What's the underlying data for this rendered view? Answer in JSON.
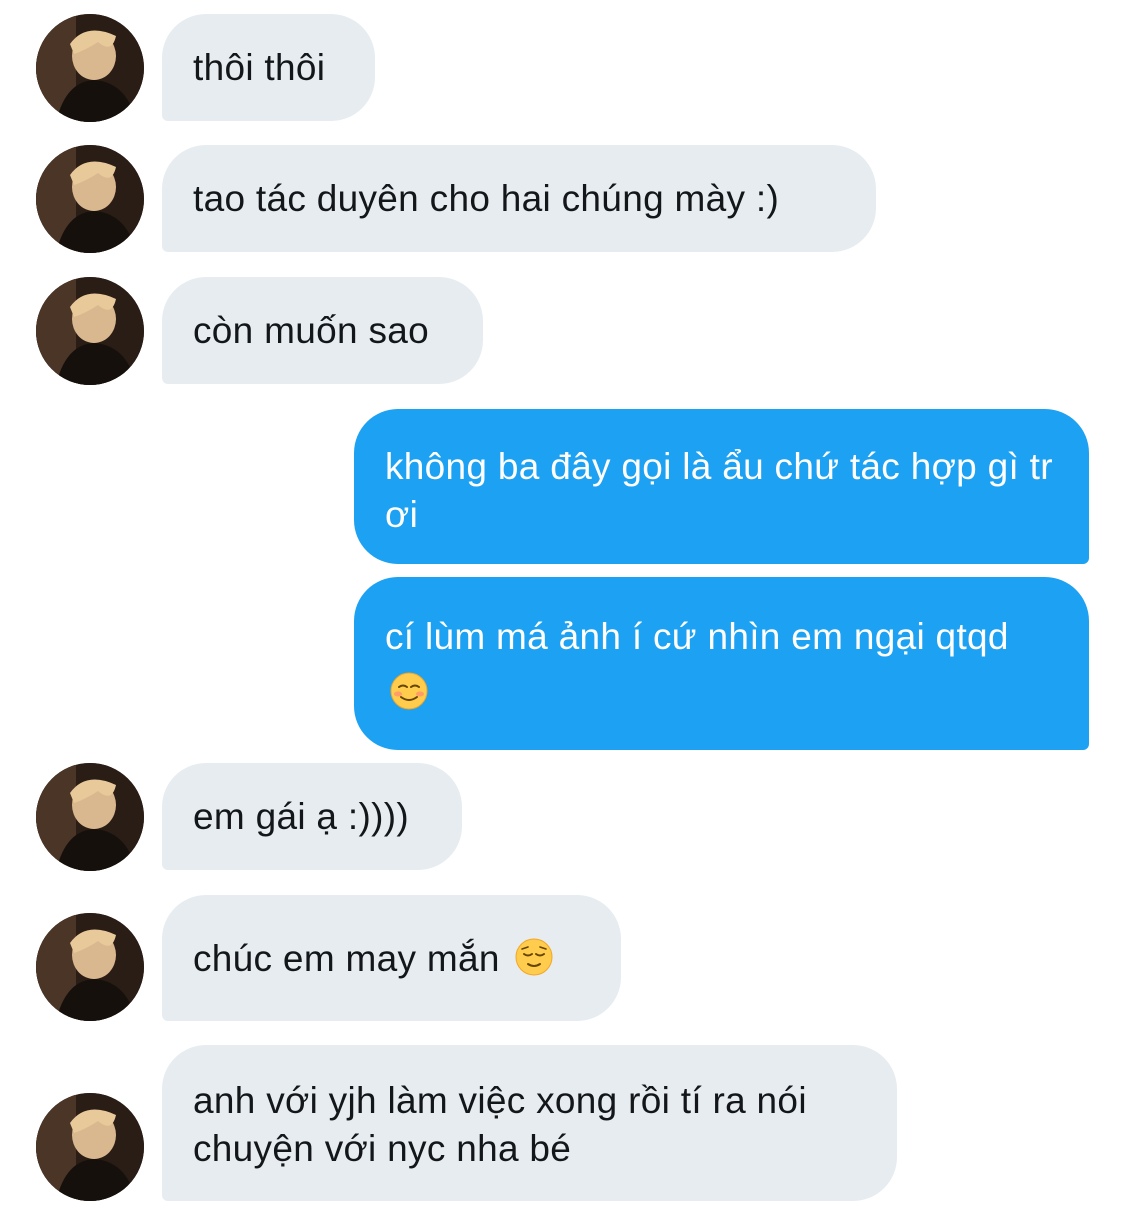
{
  "conversation": {
    "messages": [
      {
        "from": "other",
        "text": "thôi thôi"
      },
      {
        "from": "other",
        "text": "tao tác duyên cho hai chúng mày :)"
      },
      {
        "from": "other",
        "text": "còn muốn sao"
      },
      {
        "from": "me",
        "text": "không ba đây gọi là ẩu chứ tác hợp gì tr ơi"
      },
      {
        "from": "me",
        "text": "cí lùm má ảnh í cứ nhìn em ngại qtqd",
        "emoji": "smiling-face-icon"
      },
      {
        "from": "other",
        "text": "em gái ạ :))))"
      },
      {
        "from": "other",
        "text": "chúc em may mắn",
        "emoji": "relieved-face-icon"
      },
      {
        "from": "other",
        "text": "anh với yjh làm việc xong rồi tí ra nói chuyện với nyc nha bé"
      }
    ]
  },
  "colors": {
    "incoming_bubble": "#e6ecf0",
    "outgoing_bubble": "#1da1f2",
    "incoming_text": "#14171a",
    "outgoing_text": "#ffffff"
  }
}
